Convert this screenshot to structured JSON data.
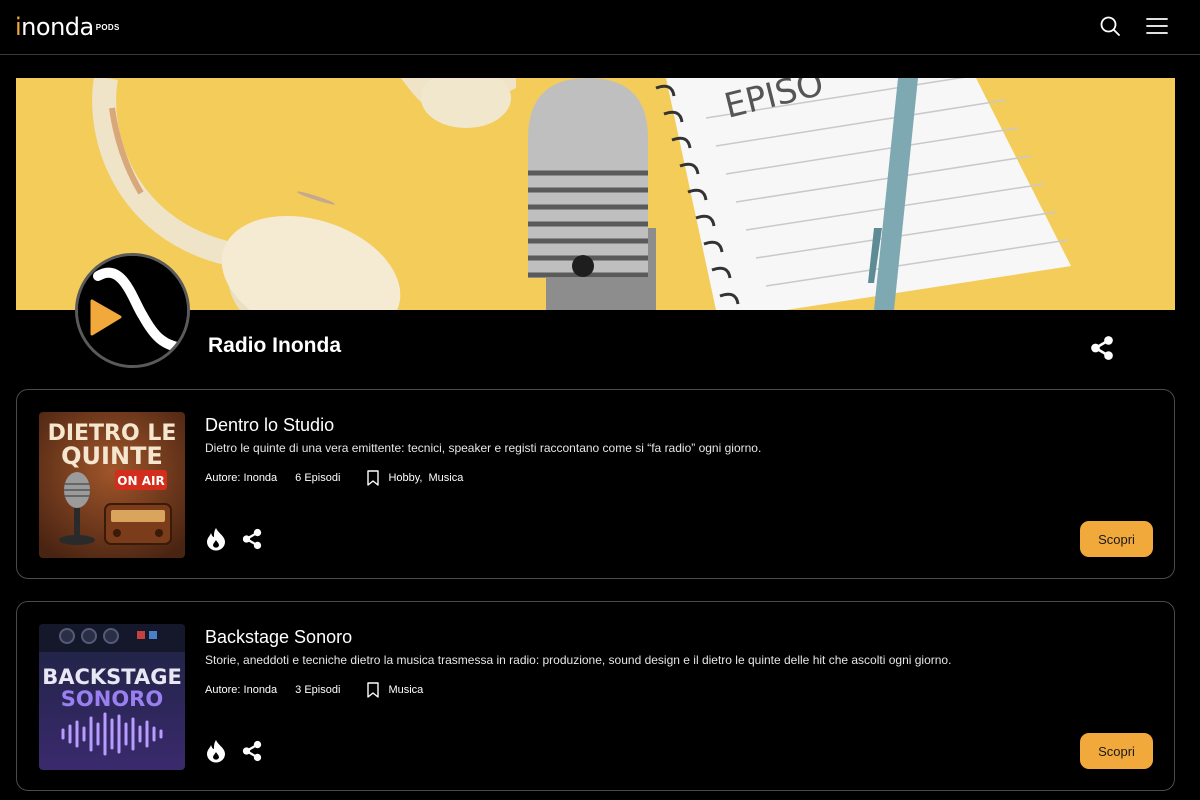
{
  "header": {
    "logo_text_pre": "i",
    "logo_text_main": "nonda",
    "logo_pods": "PODS",
    "search_icon": "search-icon",
    "menu_icon": "hamburger-menu-icon"
  },
  "banner": {
    "notebook_text": "EPISO"
  },
  "channel": {
    "name": "Radio Inonda",
    "share_icon": "share-icon"
  },
  "podcasts": [
    {
      "title": "Dentro lo Studio",
      "description": "Dietro le quinte di una vera emittente: tecnici, speaker e registi raccontano come si “fa radio” ogni giorno.",
      "author": "Autore: Inonda",
      "episodes": "6 Episodi",
      "tags": [
        "Hobby,",
        "Musica"
      ],
      "cover_line1": "DIETRO LE",
      "cover_line2": "QUINTE",
      "cover_badge": "ON AIR",
      "button": "Scopri"
    },
    {
      "title": "Backstage Sonoro",
      "description": "Storie, aneddoti e tecniche dietro la musica trasmessa in radio: produzione, sound design e il dietro le quinte delle hit che ascolti ogni giorno.",
      "author": "Autore: Inonda",
      "episodes": "3 Episodi",
      "tags": [
        "Musica"
      ],
      "cover_line1": "BACKSTAGE",
      "cover_line2": "SONORO",
      "button": "Scopri"
    }
  ],
  "colors": {
    "accent": "#f2a93b",
    "background": "#000000",
    "banner_yellow": "#f3cc5a"
  }
}
